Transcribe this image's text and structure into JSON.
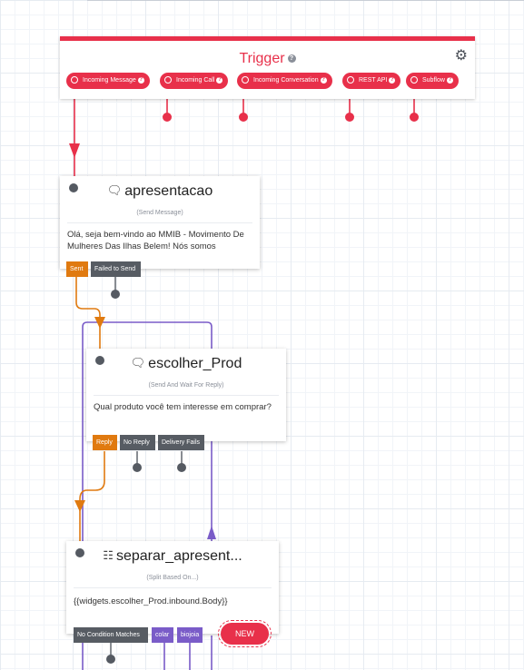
{
  "trigger": {
    "title": "Trigger",
    "help": "?",
    "gear_icon": "gears-icon",
    "pills": [
      {
        "label": "Incoming Message"
      },
      {
        "label": "Incoming Call"
      },
      {
        "label": "Incoming Conversation"
      },
      {
        "label": "REST API"
      },
      {
        "label": "Subflow"
      }
    ]
  },
  "widgets": [
    {
      "name": "apresentacao",
      "type": "(Send Message)",
      "body": "Olá, seja bem-vindo ao MMIB - Movimento De Mulheres Das Ilhas Belem! Nós somos",
      "transitions": [
        "Sent",
        "Failed to Send"
      ]
    },
    {
      "name": "escolher_Prod",
      "type": "(Send And Wait For Reply)",
      "body": "Qual produto você tem interesse em comprar?",
      "transitions": [
        "Reply",
        "No Reply",
        "Delivery Fails"
      ]
    },
    {
      "name": "separar_apresent...",
      "type": "(Split Based On...)",
      "body": "{{widgets.escolher_Prod.inbound.Body}}",
      "transitions": [
        "No Condition Matches",
        "colar",
        "biojoia"
      ],
      "new_label": "NEW"
    }
  ],
  "colors": {
    "trigger_red": "#e8304a",
    "transition_orange": "#e07a10",
    "transition_gray": "#575c63",
    "transition_purple": "#7a5cc8"
  }
}
